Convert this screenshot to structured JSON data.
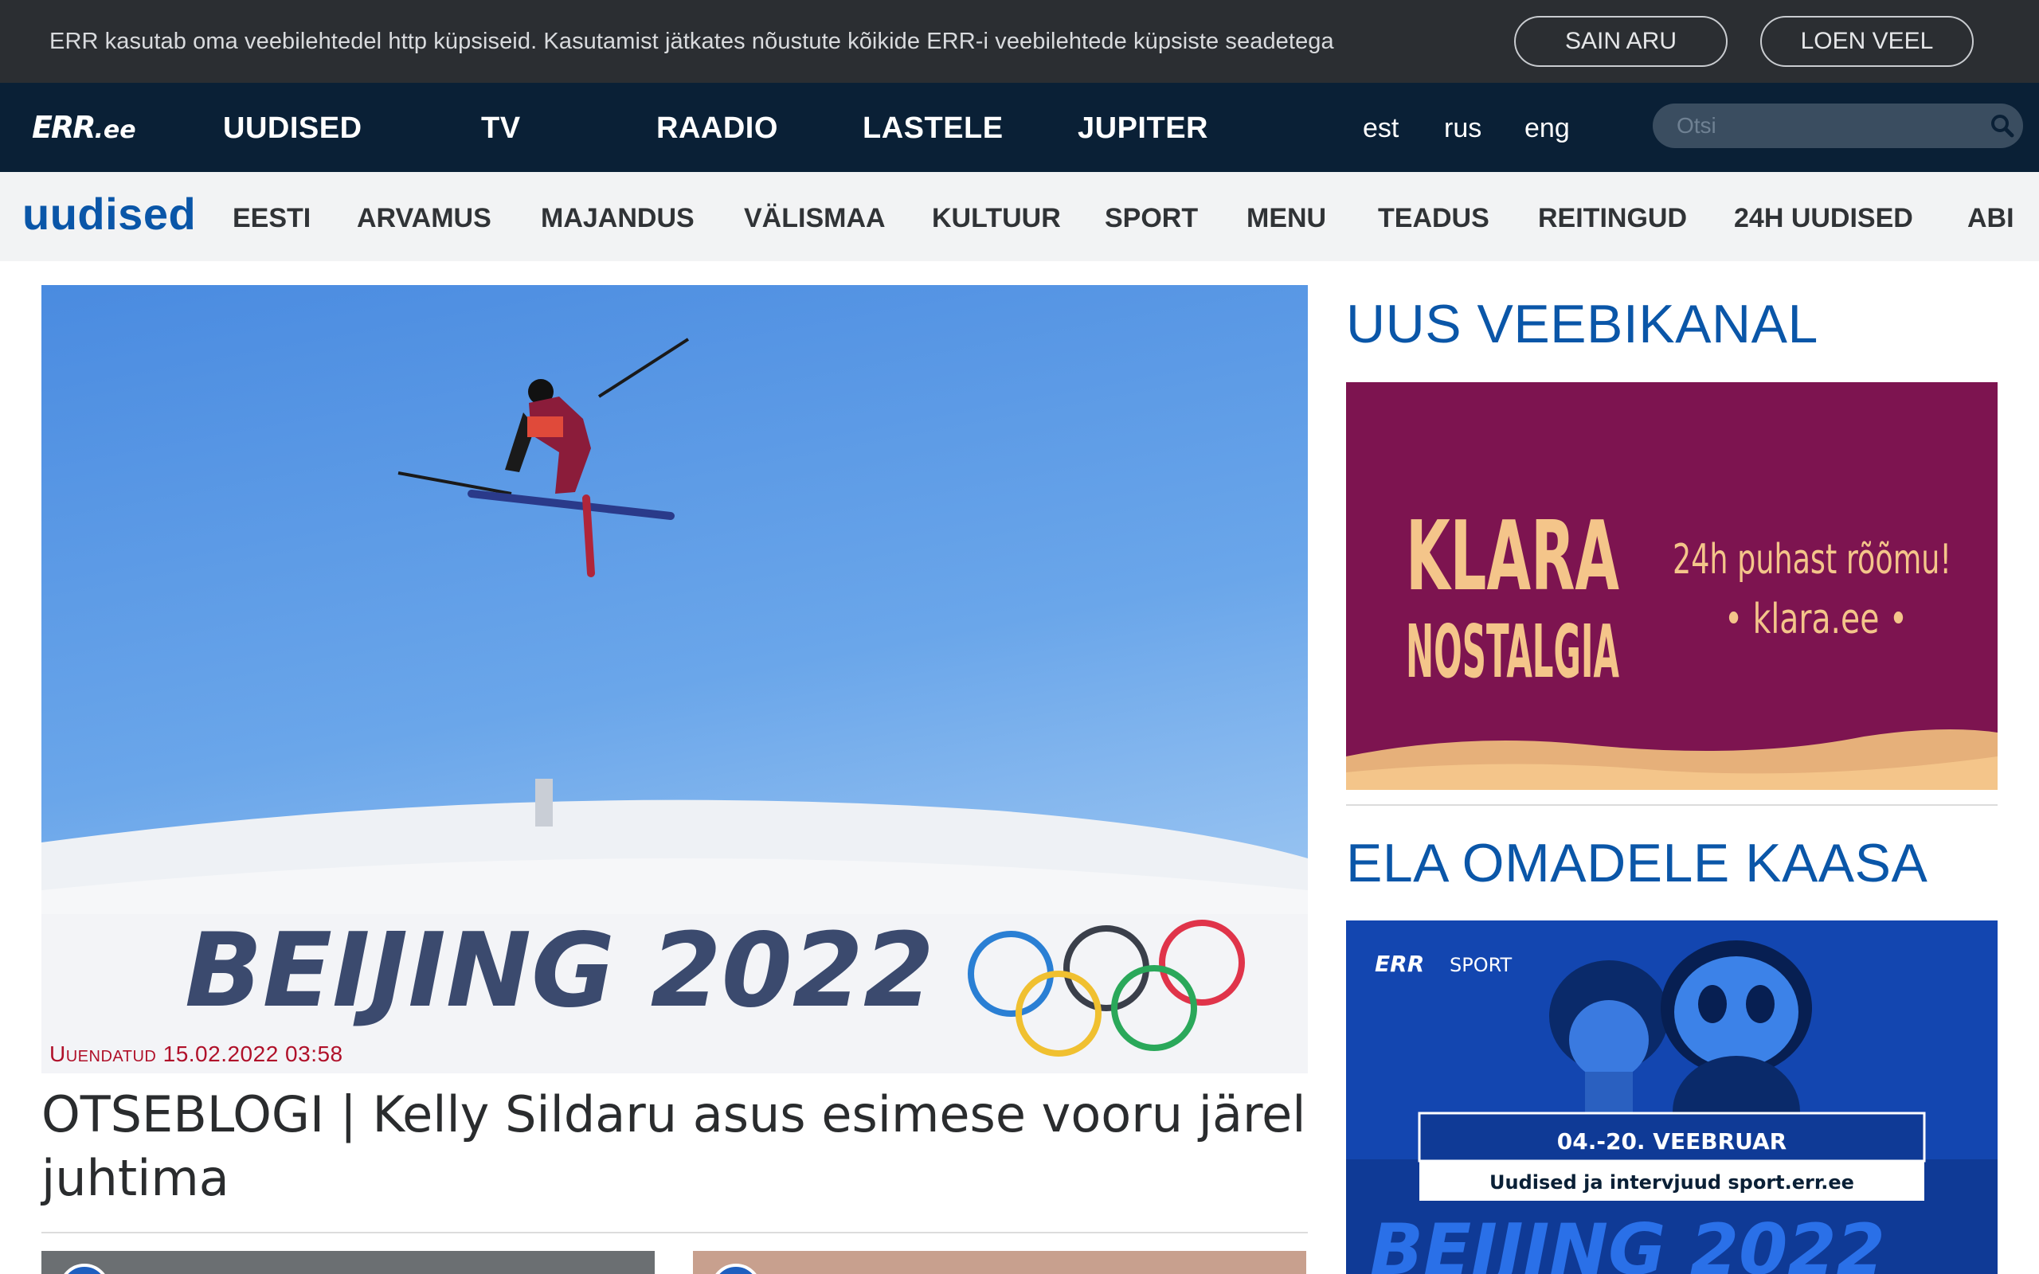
{
  "cookie": {
    "text": "ERR kasutab oma veebilehtedel http küpsiseid. Kasutamist jätkates nõustute kõikide ERR-i veebilehtede küpsiste seadetega",
    "accept_label": "SAIN ARU",
    "more_label": "LOEN VEEL"
  },
  "header": {
    "logo_main": "ERR",
    "logo_suffix": ".ee",
    "nav": [
      "UUDISED",
      "TV",
      "RAADIO",
      "LASTELE",
      "JUPITER"
    ],
    "languages": [
      "est",
      "rus",
      "eng"
    ],
    "search_placeholder": "Otsi",
    "icons": {
      "search": "search-icon"
    }
  },
  "subnav": {
    "title": "uudised",
    "items": [
      "EESTI",
      "ARVAMUS",
      "MAJANDUS",
      "VÄLISMAA",
      "KULTUUR",
      "SPORT",
      "MENU",
      "TEADUS",
      "REITINGUD",
      "24H UUDISED",
      "ABI"
    ]
  },
  "hero": {
    "updated": "Uuendatud 15.02.2022 03:58",
    "headline": "OTSEBLOGI | Kelly Sildaru asus esimese vooru järel juhtima",
    "image_text": "BEIJING 2022"
  },
  "sidebar": {
    "heading_1": "UUS VEEBIKANAL",
    "heading_2": "ELA OMADELE KAASA",
    "klara": {
      "title_line1": "KLARA",
      "title_line2": "NOSTALGIA",
      "tagline": "24h puhast rõõmu!",
      "url": "• klara.ee •"
    },
    "sport": {
      "logo": "ERR",
      "logo_label": "SPORT",
      "dates": "04.-20. VEEBRUAR",
      "subtitle": "Uudised ja intervjuud sport.err.ee",
      "bottom_text": "BEIJING 2022"
    }
  },
  "colors": {
    "cookie_bg": "#2b2e32",
    "nav_bg": "#0a2036",
    "accent_blue": "#0a56a8",
    "update_red": "#b0112a",
    "klara_bg": "#7d1450",
    "klara_text": "#f4c58a",
    "sport_bg": "#1346b0"
  }
}
